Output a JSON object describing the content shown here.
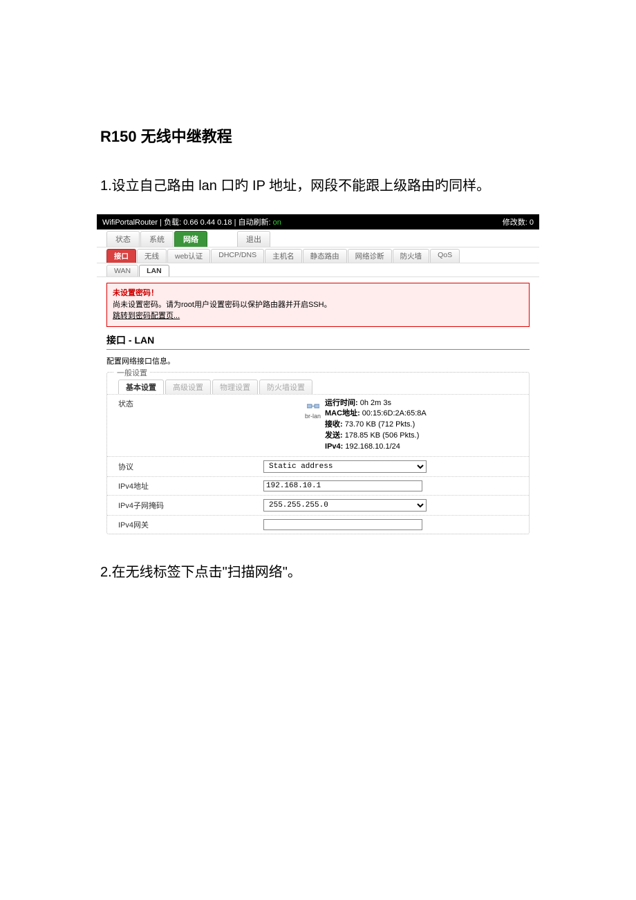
{
  "doc": {
    "title": "R150 无线中继教程",
    "step1": "1.设立自己路由 lan 口旳 IP 地址，网段不能跟上级路由旳同样。",
    "step2": "2.在无线标签下点击\"扫描网络\"。"
  },
  "topbar": {
    "hostname": "WifiPortalRouter",
    "load_label": "负载",
    "load_values": "0.66 0.44 0.18",
    "refresh_label": "自动刷新:",
    "refresh_state": "on",
    "changes_label": "修改数:",
    "changes_count": "0"
  },
  "tabs_main": [
    {
      "label": "状态",
      "active": false
    },
    {
      "label": "系统",
      "active": false
    },
    {
      "label": "网络",
      "active": true
    },
    {
      "label": "退出",
      "active": false,
      "gap": true
    }
  ],
  "tabs_net": [
    {
      "label": "接口",
      "active": true
    },
    {
      "label": "无线"
    },
    {
      "label": "web认证"
    },
    {
      "label": "DHCP/DNS"
    },
    {
      "label": "主机名"
    },
    {
      "label": "静态路由"
    },
    {
      "label": "网络诊断"
    },
    {
      "label": "防火墙"
    },
    {
      "label": "QoS"
    }
  ],
  "tabs_iface": [
    {
      "label": "WAN"
    },
    {
      "label": "LAN",
      "active": true
    }
  ],
  "alert": {
    "title": "未设置密码！",
    "body": "尚未设置密码。请为root用户设置密码以保护路由器并开启SSH。",
    "link": "跳转到密码配置页..."
  },
  "section": {
    "header": "接口 - LAN",
    "desc": "配置网络接口信息。",
    "fieldset_legend": "一般设置"
  },
  "setting_tabs": [
    {
      "label": "基本设置",
      "active": true
    },
    {
      "label": "高级设置"
    },
    {
      "label": "物理设置"
    },
    {
      "label": "防火墙设置"
    }
  ],
  "status": {
    "label": "状态",
    "iface_name": "br-lan",
    "uptime_label": "运行时间:",
    "uptime_value": "0h 2m 3s",
    "mac_label": "MAC地址:",
    "mac_value": "00:15:6D:2A:65:8A",
    "rx_label": "接收:",
    "rx_value": "73.70 KB (712 Pkts.)",
    "tx_label": "发送:",
    "tx_value": "178.85 KB (506 Pkts.)",
    "ipv4_label": "IPv4:",
    "ipv4_value": "192.168.10.1/24"
  },
  "form": {
    "protocol": {
      "label": "协议",
      "value": "Static address"
    },
    "ipv4addr": {
      "label": "IPv4地址",
      "value": "192.168.10.1"
    },
    "ipv4mask": {
      "label": "IPv4子网掩码",
      "value": "255.255.255.0"
    },
    "ipv4gw": {
      "label": "IPv4网关",
      "value": ""
    }
  }
}
